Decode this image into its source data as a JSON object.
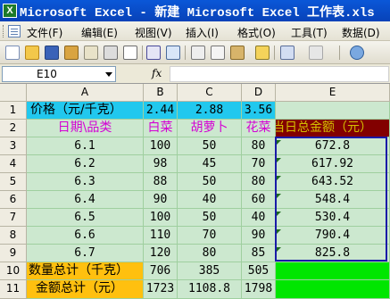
{
  "window": {
    "app_icon": "X",
    "title": "Microsoft Excel - 新建 Microsoft Excel 工作表.xls"
  },
  "menu": [
    "文件(F)",
    "编辑(E)",
    "视图(V)",
    "插入(I)",
    "格式(O)",
    "工具(T)",
    "数据(D)"
  ],
  "toolbar_icons": [
    "new-icon",
    "open-icon",
    "save-icon",
    "permission-icon",
    "email-icon",
    "print-icon",
    "print-preview-icon",
    "spelling-icon",
    "research-icon",
    "cut-icon",
    "copy-icon",
    "paste-icon",
    "format-painter-icon",
    "undo-icon",
    "redo-icon",
    "hyperlink-icon"
  ],
  "formula_bar": {
    "name_box": "E10",
    "fx_label": "fx",
    "formula": ""
  },
  "columns": [
    "A",
    "B",
    "C",
    "D",
    "E"
  ],
  "rows": [
    "1",
    "2",
    "3",
    "4",
    "5",
    "6",
    "7",
    "8",
    "9",
    "10",
    "11"
  ],
  "sheet": {
    "r1": {
      "a": "价格（元/千克）",
      "b": "2.44",
      "c": "2.88",
      "d": "3.56"
    },
    "r2": {
      "a": "日期\\品类",
      "b": "白菜",
      "c": "胡萝卜",
      "d": "花菜",
      "e": "当日总金额（元）"
    },
    "data": [
      {
        "a": "6.1",
        "b": "100",
        "c": "50",
        "d": "80",
        "e": "672.8"
      },
      {
        "a": "6.2",
        "b": "98",
        "c": "45",
        "d": "70",
        "e": "617.92"
      },
      {
        "a": "6.3",
        "b": "88",
        "c": "50",
        "d": "80",
        "e": "643.52"
      },
      {
        "a": "6.4",
        "b": "90",
        "c": "40",
        "d": "60",
        "e": "548.4"
      },
      {
        "a": "6.5",
        "b": "100",
        "c": "50",
        "d": "40",
        "e": "530.4"
      },
      {
        "a": "6.6",
        "b": "110",
        "c": "70",
        "d": "90",
        "e": "790.4"
      },
      {
        "a": "6.7",
        "b": "120",
        "c": "80",
        "d": "85",
        "e": "825.8"
      }
    ],
    "r10": {
      "a": "数量总计（千克）",
      "b": "706",
      "c": "385",
      "d": "505"
    },
    "r11": {
      "a": "金额总计（元）",
      "b": "1723",
      "c": "1108.8",
      "d": "1798"
    }
  },
  "colors": {
    "cell_green": "#cce8cf",
    "header_cyan": "#21c8ee",
    "total_gold": "#ffc00f",
    "e2_maroon": "#820000",
    "highlight_lime": "#00e600",
    "selection_blue": "#1a1aa8"
  }
}
